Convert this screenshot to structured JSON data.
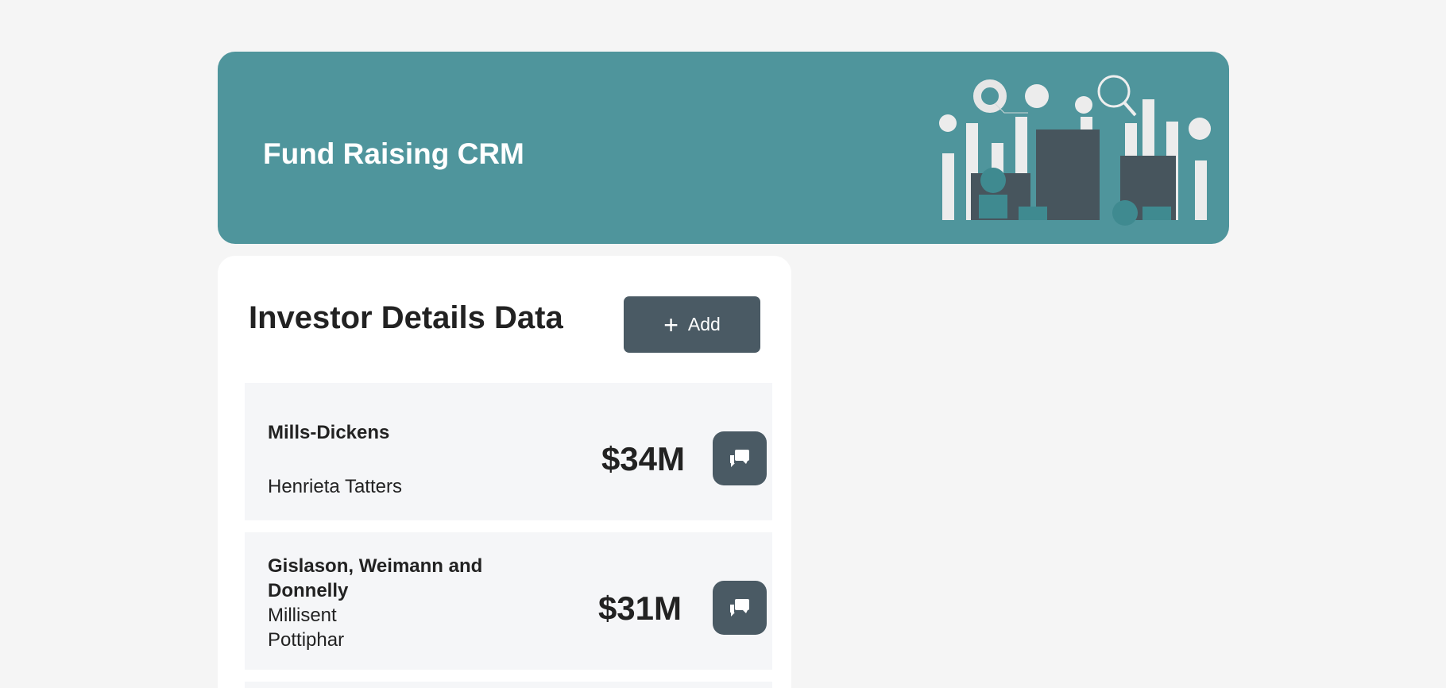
{
  "header": {
    "title": "Fund Raising CRM"
  },
  "investors": {
    "title": "Investor Details Data",
    "add_label": "Add",
    "rows": [
      {
        "company": "Mills-Dickens",
        "contact": "Henrieta Tatters",
        "amount": "$34M"
      },
      {
        "company": "Gislason, Weimann and Donnelly",
        "contact": "Millisent Pottiphar",
        "amount": "$31M"
      }
    ]
  },
  "colors": {
    "banner": "#4f959c",
    "button": "#4a5a64",
    "row_bg": "#f5f6f8"
  }
}
